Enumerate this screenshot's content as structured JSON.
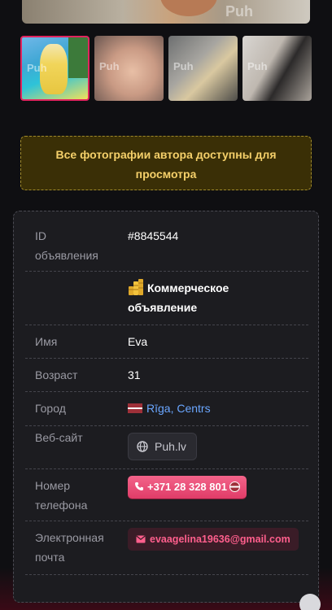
{
  "gallery": {
    "thumbnails": [
      {
        "alt": "photo-1",
        "watermark": "Puh"
      },
      {
        "alt": "photo-2",
        "watermark": "Puh"
      },
      {
        "alt": "photo-3",
        "watermark": "Puh"
      },
      {
        "alt": "photo-4",
        "watermark": "Puh"
      }
    ]
  },
  "notice": {
    "line1": "Все фотографии автора доступны для",
    "line2": "просмотра"
  },
  "details": {
    "id_label_1": "ID",
    "id_label_2": "объявления",
    "id_value": "#8845544",
    "commercial_line1": "Коммерческое",
    "commercial_line2": "объявление",
    "name_label": "Имя",
    "name_value": "Eva",
    "age_label": "Возраст",
    "age_value": "31",
    "city_label": "Город",
    "city_value": "Rīga, Centrs",
    "website_label": "Веб-сайт",
    "website_value": "Puh.lv",
    "phone_label_1": "Номер",
    "phone_label_2": "телефона",
    "phone_value": "+371 28 328 801",
    "email_label_1": "Электронная",
    "email_label_2": "почта",
    "email_value": "evaagelina19636@gmail.com"
  },
  "colors": {
    "accent_pink": "#e03c68",
    "notice_text": "#f5d06a",
    "link_blue": "#6aa6ff"
  }
}
